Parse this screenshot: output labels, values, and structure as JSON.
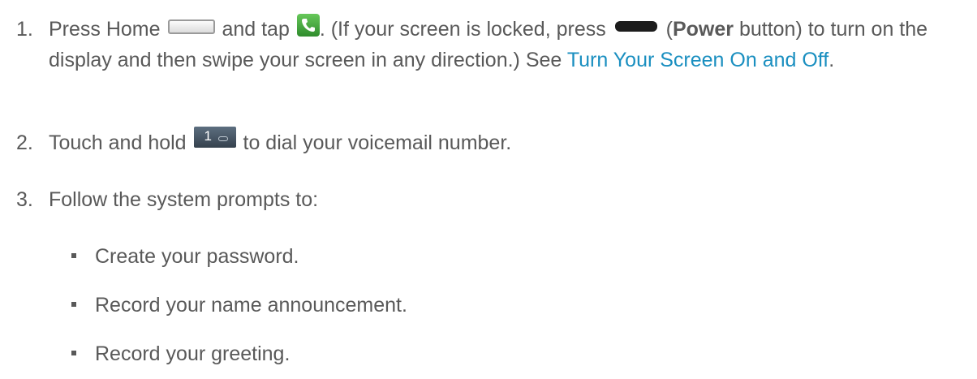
{
  "steps": [
    {
      "number": "1.",
      "parts": {
        "press_home": "Press Home",
        "and_tap": "and tap",
        "locked_text": ". (If your screen is locked, press",
        "open_paren": "(",
        "power_bold": "Power",
        "rest": "button) to turn on the display and then swipe your screen in any direction.) See",
        "link": "Turn Your Screen On and Off",
        "end": "."
      },
      "icons": [
        "home-button-icon",
        "phone-app-icon",
        "power-button-icon"
      ]
    },
    {
      "number": "2.",
      "parts": {
        "touch_hold": "Touch and hold",
        "key_digit": "1",
        "rest": "to dial your voicemail number."
      },
      "icons": [
        "voicemail-key-icon"
      ]
    },
    {
      "number": "3.",
      "text": "Follow the system prompts to:"
    }
  ],
  "bullets": [
    "Create your password.",
    "Record your name announcement.",
    "Record your greeting."
  ],
  "colors": {
    "text": "#595959",
    "link": "#1a8fc0",
    "phone_icon": "#3fa23a",
    "key_icon": "#4a5a6a"
  }
}
